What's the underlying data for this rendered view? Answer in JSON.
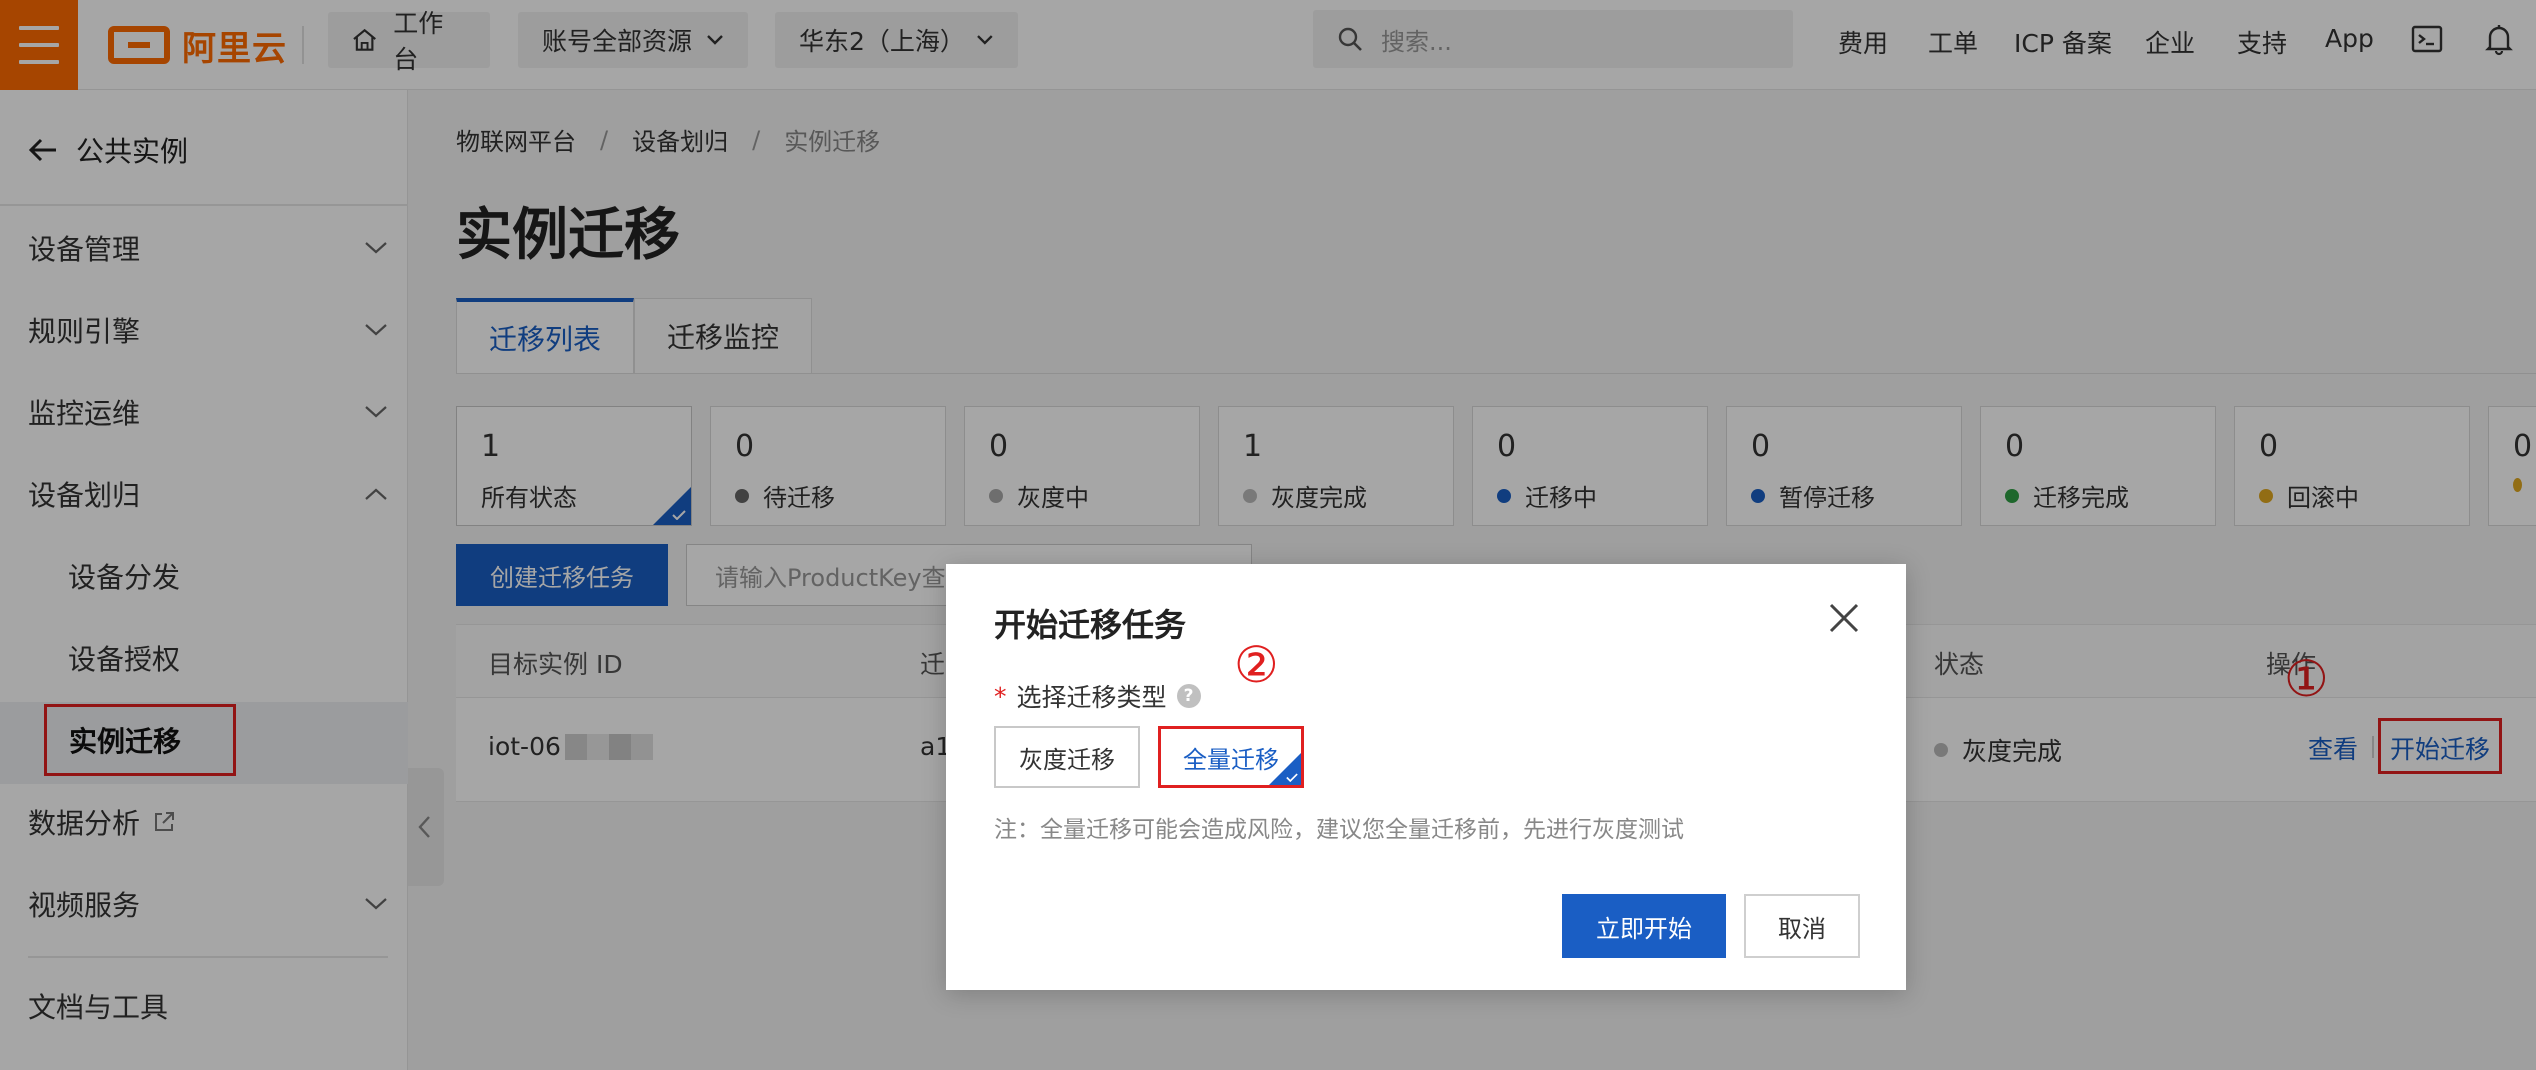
{
  "topbar": {
    "brand": "阿里云",
    "workbench": "工作台",
    "account_scope": "账号全部资源",
    "region": "华东2（上海）",
    "search_placeholder": "搜索...",
    "links": [
      "费用",
      "工单",
      "ICP 备案",
      "企业",
      "支持",
      "App"
    ],
    "brand_color": "#ff6a00"
  },
  "sidebar": {
    "back_label": "公共实例",
    "items": [
      {
        "label": "设备管理",
        "expanded": false
      },
      {
        "label": "规则引擎",
        "expanded": false
      },
      {
        "label": "监控运维",
        "expanded": false
      },
      {
        "label": "设备划归",
        "expanded": true
      },
      {
        "label": "数据分析",
        "external": true
      },
      {
        "label": "视频服务",
        "expanded": false
      },
      {
        "label": "文档与工具"
      }
    ],
    "subitems": [
      "设备分发",
      "设备授权",
      "实例迁移"
    ],
    "active": "实例迁移"
  },
  "breadcrumb": [
    "物联网平台",
    "设备划归",
    "实例迁移"
  ],
  "page_title": "实例迁移",
  "tabs": [
    "迁移列表",
    "迁移监控"
  ],
  "active_tab": "迁移列表",
  "stats": [
    {
      "count": "1",
      "label": "所有状态",
      "dot": "",
      "selected": true
    },
    {
      "count": "0",
      "label": "待迁移",
      "dot": "#666666"
    },
    {
      "count": "0",
      "label": "灰度中",
      "dot": "#aaaaaa"
    },
    {
      "count": "1",
      "label": "灰度完成",
      "dot": "#bbbbbb"
    },
    {
      "count": "0",
      "label": "迁移中",
      "dot": "#1a5ec4"
    },
    {
      "count": "0",
      "label": "暂停迁移",
      "dot": "#1a5ec4"
    },
    {
      "count": "0",
      "label": "迁移完成",
      "dot": "#2e9e44"
    },
    {
      "count": "0",
      "label": "回滚中",
      "dot": "#e0a820"
    },
    {
      "count": "0",
      "label": "",
      "dot": "#e0a820"
    }
  ],
  "toolbar": {
    "create_label": "创建迁移任务",
    "filter_placeholder": "请输入ProductKey查"
  },
  "table": {
    "headers": [
      "目标实例 ID",
      "迁",
      "状态",
      "操作"
    ],
    "rows": [
      {
        "instance_id": "iot-06",
        "col2": "a1",
        "status": "灰度完成",
        "view": "查看",
        "start": "开始迁移"
      }
    ]
  },
  "annotations": {
    "step1": "①",
    "step2": "②"
  },
  "modal": {
    "title": "开始迁移任务",
    "field_label": "选择迁移类型",
    "required_mark": "*",
    "help": "?",
    "options": [
      "灰度迁移",
      "全量迁移"
    ],
    "selected_option": "全量迁移",
    "note": "注：全量迁移可能会造成风险，建议您全量迁移前，先进行灰度测试",
    "confirm_label": "立即开始",
    "cancel_label": "取消"
  },
  "colors": {
    "primary": "#1a5ec4",
    "highlight": "#e02020"
  }
}
